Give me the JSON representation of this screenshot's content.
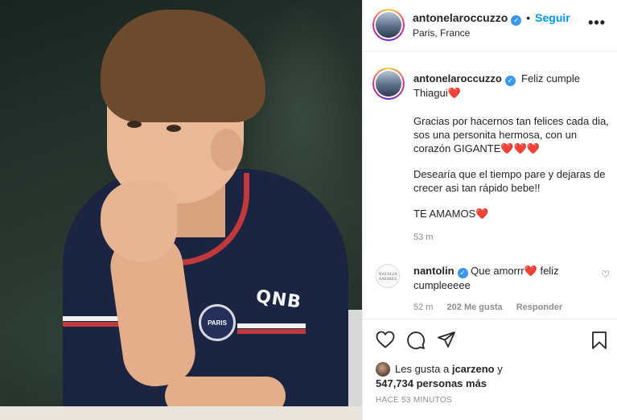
{
  "post": {
    "author": "antonelaroccuzzo",
    "follow_label": "Seguir",
    "dot": "•",
    "location": "Paris, France",
    "more": "•••",
    "photo": {
      "badge_text": "PARIS",
      "sponsor_text": "QNB"
    }
  },
  "caption": {
    "author": "antonelaroccuzzo",
    "line1": "Feliz cumple Thiagui",
    "heart": "❤️",
    "para2": "Gracias por hacernos tan felices cada dia, sos una personita hermosa, con un corazón GIGANTE",
    "hearts3": "❤️❤️❤️",
    "para3": "Desearía que el tiempo pare y dejaras de crecer asi tan rápido bebe!!",
    "para4": "TE AMAMOS",
    "time": "53 m"
  },
  "comment": {
    "avatar_text": "NATALIA ANDRES",
    "author": "nantolin",
    "text": "Que amorrr",
    "heart": "❤️",
    "text2": "feliz cumpleeeee",
    "time": "52 m",
    "likes": "202 Me gusta",
    "reply": "Responder"
  },
  "likes": {
    "prefix": "Les gusta a",
    "user": "jcarzeno",
    "suffix": "y",
    "count_line": "547,734 personas más"
  },
  "timestamp": "HACE 53 MINUTOS",
  "colors": {
    "accent": "#0095f6",
    "verified": "#3897f0",
    "muted": "#8e8e8e"
  }
}
